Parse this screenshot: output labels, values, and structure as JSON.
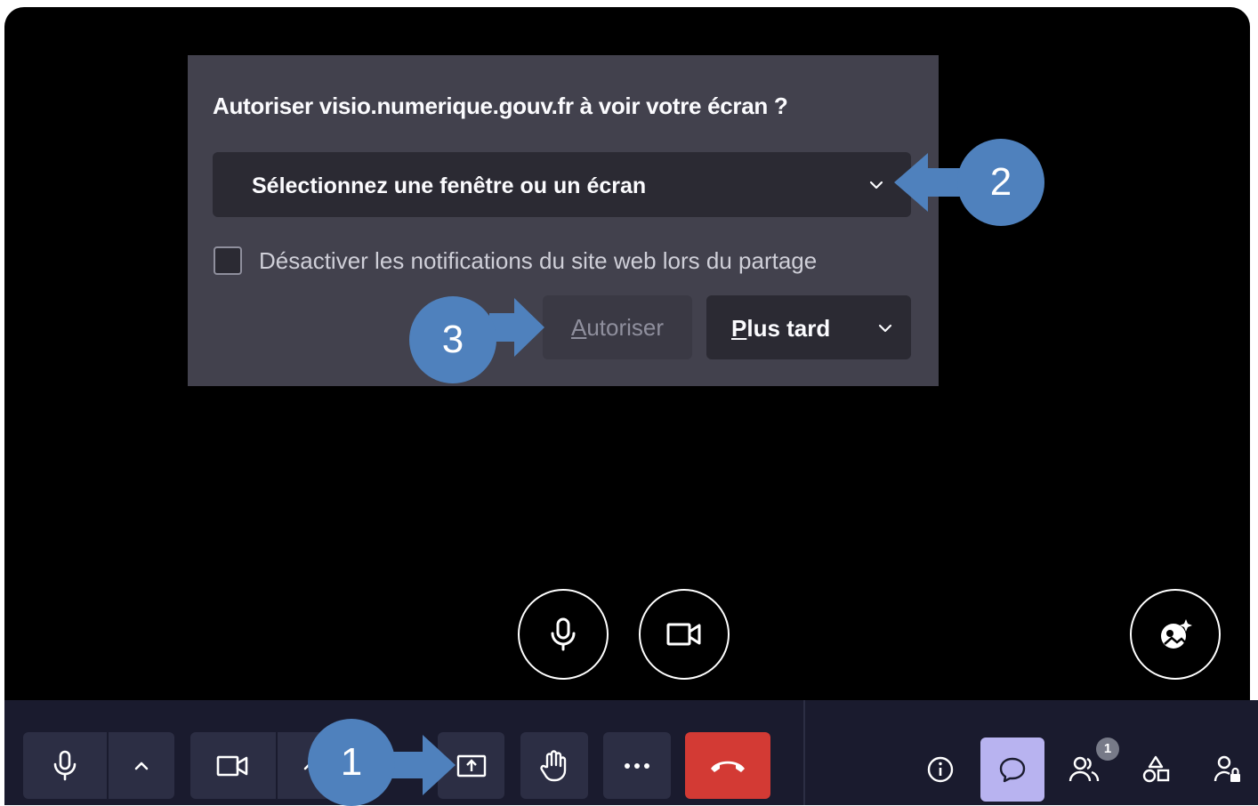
{
  "dialog": {
    "title": "Autoriser visio.numerique.gouv.fr à voir votre écran ?",
    "select_value": "Sélectionnez une fenêtre ou un écran",
    "checkbox_label": "Désactiver les notifications du site web lors du partage",
    "checkbox_checked": false,
    "allow_label_access_key": "A",
    "allow_label_rest": "utoriser",
    "later_label_access_key": "P",
    "later_label_rest": "lus tard"
  },
  "stage_controls": {
    "mic_icon": "microphone-icon",
    "camera_icon": "video-camera-icon",
    "effects_icon": "camera-effects-icon"
  },
  "toolbar": {
    "icons": [
      "microphone-icon",
      "chevron-up-icon",
      "video-camera-icon",
      "chevron-up-icon",
      "share-screen-icon",
      "raise-hand-icon",
      "more-options-icon",
      "hang-up-icon"
    ],
    "hangup_color": "#d33a34"
  },
  "right_toolbar": {
    "icons": [
      "info-icon",
      "chat-icon",
      "participants-icon",
      "tools-icon",
      "admin-icon"
    ],
    "participants_badge": "1",
    "active_color": "#b8b3f0"
  },
  "callouts": {
    "c1": "1",
    "c2": "2",
    "c3": "3",
    "color": "#4f81bd"
  }
}
